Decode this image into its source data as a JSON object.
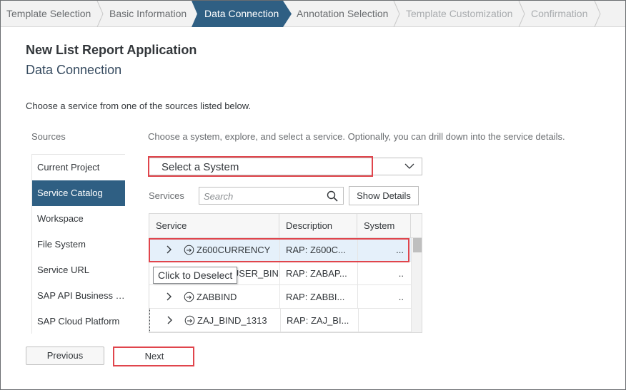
{
  "wizard": {
    "steps": [
      {
        "label": "Template Selection",
        "state": "done"
      },
      {
        "label": "Basic Information",
        "state": "done"
      },
      {
        "label": "Data Connection",
        "state": "active"
      },
      {
        "label": "Annotation Selection",
        "state": "done"
      },
      {
        "label": "Template Customization",
        "state": "disabled"
      },
      {
        "label": "Confirmation",
        "state": "disabled"
      }
    ],
    "active_color": "#2f5f83"
  },
  "header": {
    "title": "New List Report Application",
    "subtitle": "Data Connection",
    "instruction": "Choose a service from one of the sources listed below."
  },
  "sources": {
    "label": "Sources",
    "items": [
      {
        "label": "Current Project",
        "selected": false
      },
      {
        "label": "Service Catalog",
        "selected": true
      },
      {
        "label": "Workspace",
        "selected": false
      },
      {
        "label": "File System",
        "selected": false
      },
      {
        "label": "Service URL",
        "selected": false
      },
      {
        "label": "SAP API Business Hub",
        "selected": false
      },
      {
        "label": "SAP Cloud Platform",
        "selected": false
      }
    ]
  },
  "main": {
    "explore_text": "Choose a system, explore, and select a service. Optionally, you can drill down into the service details.",
    "system_select": {
      "value": "Select a System"
    },
    "services_label": "Services",
    "search_placeholder": "Search",
    "show_details_label": "Show Details",
    "table": {
      "columns": [
        "Service",
        "Description",
        "System"
      ],
      "rows": [
        {
          "service": "Z600CURRENCY",
          "description": "RAP: Z600C...",
          "system": "...",
          "selected": true
        },
        {
          "service": "ZABAP_USER_BIND",
          "description": "RAP: ZABAP...",
          "system": "..",
          "selected": false
        },
        {
          "service": "ZABBIND",
          "description": "RAP: ZABBI...",
          "system": "..",
          "selected": false
        },
        {
          "service": "ZAJ_BIND_1313",
          "description": "RAP: ZAJ_BI...",
          "system": "",
          "selected": false
        }
      ]
    },
    "tooltip": "Click to Deselect"
  },
  "footer": {
    "previous_label": "Previous",
    "next_label": "Next"
  },
  "colors": {
    "accent": "#2f5f83",
    "highlight_box": "#e0454c",
    "selected_row": "#e5f0fa"
  }
}
